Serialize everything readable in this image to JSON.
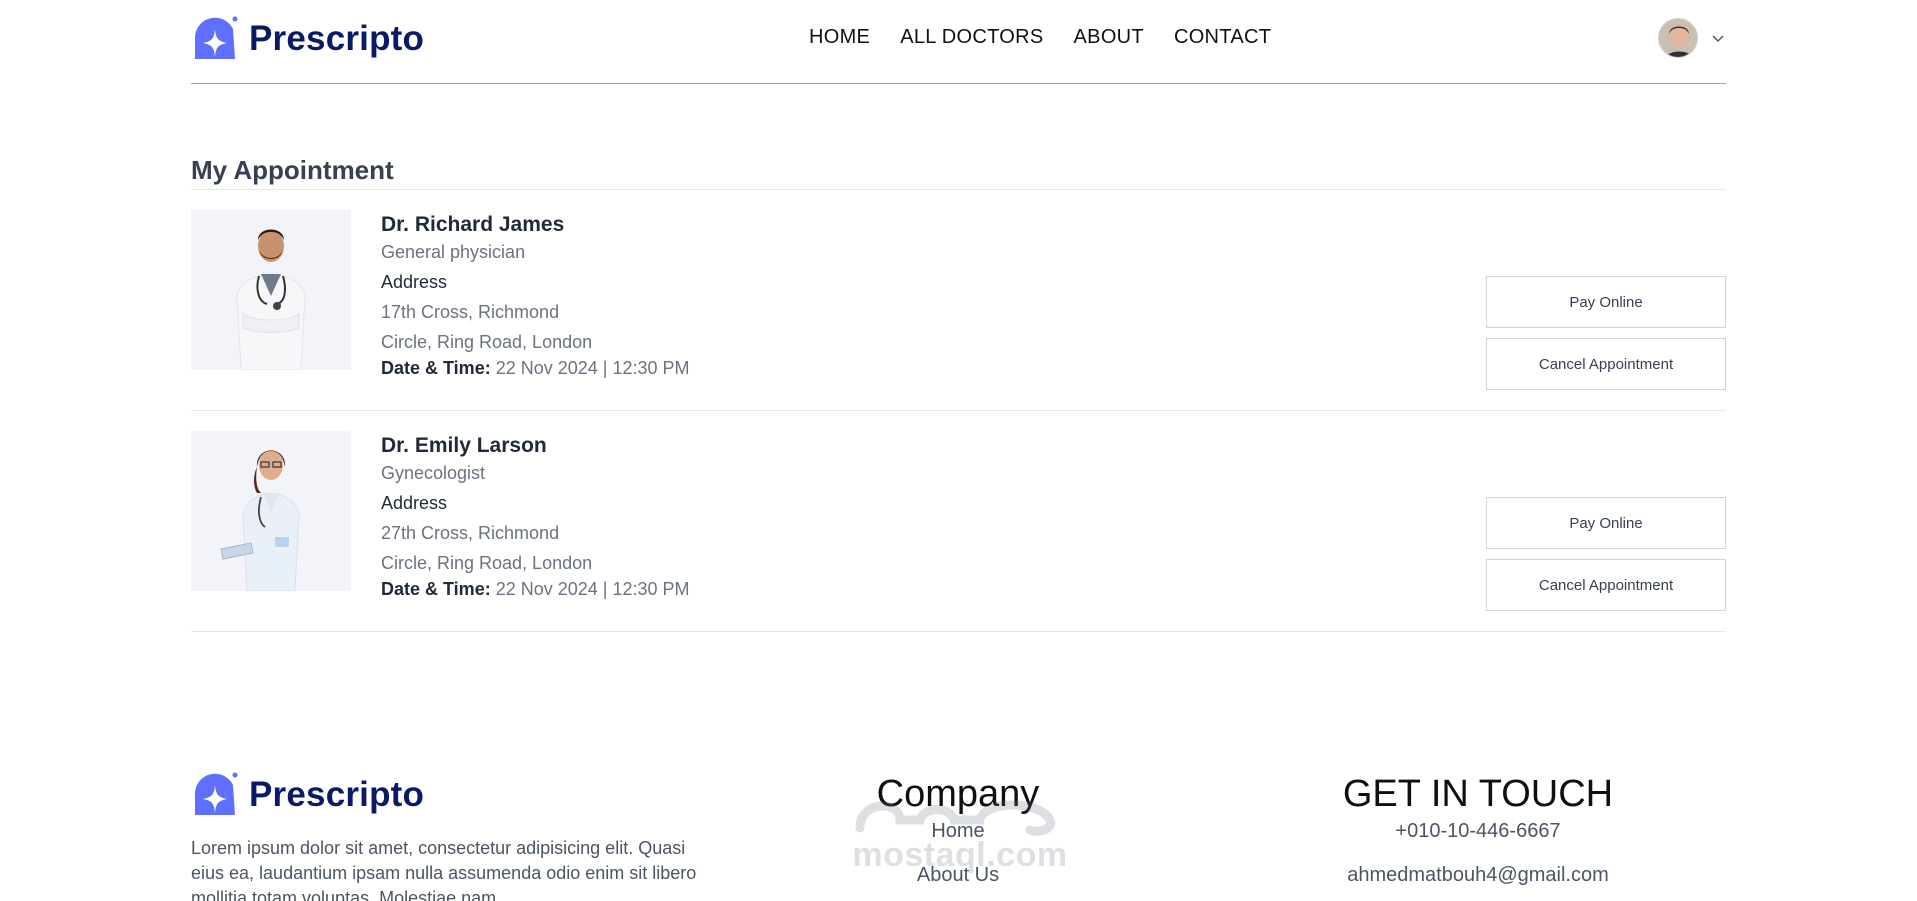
{
  "navbar": {
    "brand": "Prescripto",
    "links": [
      "HOME",
      "ALL DOCTORS",
      "ABOUT",
      "CONTACT"
    ],
    "brand_color": "#0b1a66",
    "accent_color": "#5f6fff"
  },
  "appointments": {
    "title": "My Appointment",
    "items": [
      {
        "name": "Dr. Richard James",
        "speciality": "General physician",
        "address_label": "Address",
        "address_line1": "17th Cross, Richmond",
        "address_line2": "Circle, Ring Road, London",
        "datetime_label": "Date & Time:",
        "datetime_value": " 22 Nov 2024 | 12:30 PM",
        "pay_label": "Pay Online",
        "cancel_label": "Cancel Appointment"
      },
      {
        "name": "Dr. Emily Larson",
        "speciality": "Gynecologist",
        "address_label": "Address",
        "address_line1": "27th Cross, Richmond",
        "address_line2": "Circle, Ring Road, London",
        "datetime_label": "Date & Time:",
        "datetime_value": " 22 Nov 2024 | 12:30 PM",
        "pay_label": "Pay Online",
        "cancel_label": "Cancel Appointment"
      }
    ]
  },
  "footer": {
    "brand": "Prescripto",
    "description": "Lorem ipsum dolor sit amet, consectetur adipisicing elit. Quasi eius ea, laudantium ipsam nulla assumenda odio enim sit libero mollitia totam voluptas. Molestiae nam",
    "company_heading": "Company",
    "company_links": [
      "Home",
      "About Us"
    ],
    "contact_heading": "GET IN TOUCH",
    "phone": "+010-10-446-6667",
    "email": "ahmedmatbouh4@gmail.com"
  },
  "watermark": {
    "text": "mostaql.com"
  }
}
